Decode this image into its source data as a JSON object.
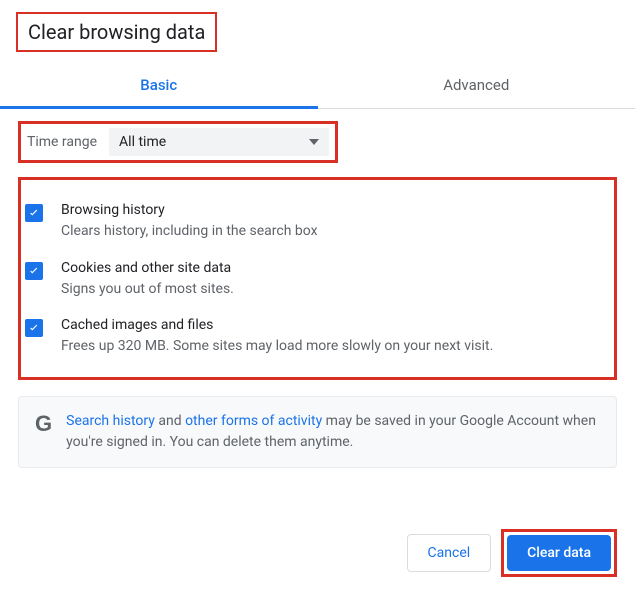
{
  "title": "Clear browsing data",
  "tabs": {
    "basic": "Basic",
    "advanced": "Advanced"
  },
  "timerange": {
    "label": "Time range",
    "value": "All time"
  },
  "options": [
    {
      "title": "Browsing history",
      "desc": "Clears history, including in the search box",
      "checked": true
    },
    {
      "title": "Cookies and other site data",
      "desc": "Signs you out of most sites.",
      "checked": true
    },
    {
      "title": "Cached images and files",
      "desc": "Frees up 320 MB. Some sites may load more slowly on your next visit.",
      "checked": true
    }
  ],
  "info": {
    "link1": "Search history",
    "mid1": " and ",
    "link2": "other forms of activity",
    "rest": " may be saved in your Google Account when you're signed in. You can delete them anytime."
  },
  "buttons": {
    "cancel": "Cancel",
    "clear": "Clear data"
  }
}
